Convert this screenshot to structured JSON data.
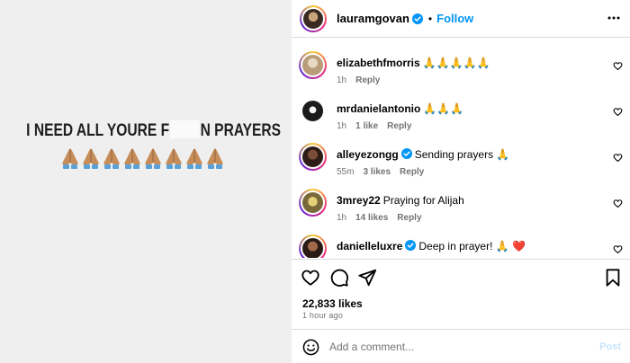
{
  "media": {
    "caption_left": "I NEED ALL YOURE F",
    "caption_right": "N PRAYERS",
    "prayer_emoji_count": 8
  },
  "header": {
    "username": "lauramgovan",
    "dot": "•",
    "follow_label": "Follow"
  },
  "comments": [
    {
      "user": "elizabethfmorris",
      "text": "🙏🙏🙏🙏🙏",
      "time": "1h",
      "likes": "",
      "reply": "Reply",
      "verified": false
    },
    {
      "user": "mrdanielantonio",
      "text": "🙏🙏🙏",
      "time": "1h",
      "likes": "1 like",
      "reply": "Reply",
      "verified": false
    },
    {
      "user": "alleyezongg",
      "text": "Sending prayers 🙏",
      "time": "55m",
      "likes": "3 likes",
      "reply": "Reply",
      "verified": true
    },
    {
      "user": "3mrey22",
      "text": "Praying for Alijah",
      "time": "1h",
      "likes": "14 likes",
      "reply": "Reply",
      "verified": false
    },
    {
      "user": "danielleluxre",
      "text": "Deep in prayer! 🙏 ❤️",
      "time": "",
      "likes": "",
      "reply": "",
      "verified": true
    }
  ],
  "stats": {
    "likes": "22,833 likes",
    "ago": "1 hour ago"
  },
  "composer": {
    "placeholder": "Add a comment...",
    "post_label": "Post"
  },
  "colors": {
    "accent": "#0095f6",
    "muted": "#737373",
    "border": "#dbdbdb",
    "media_bg": "#efefef"
  }
}
